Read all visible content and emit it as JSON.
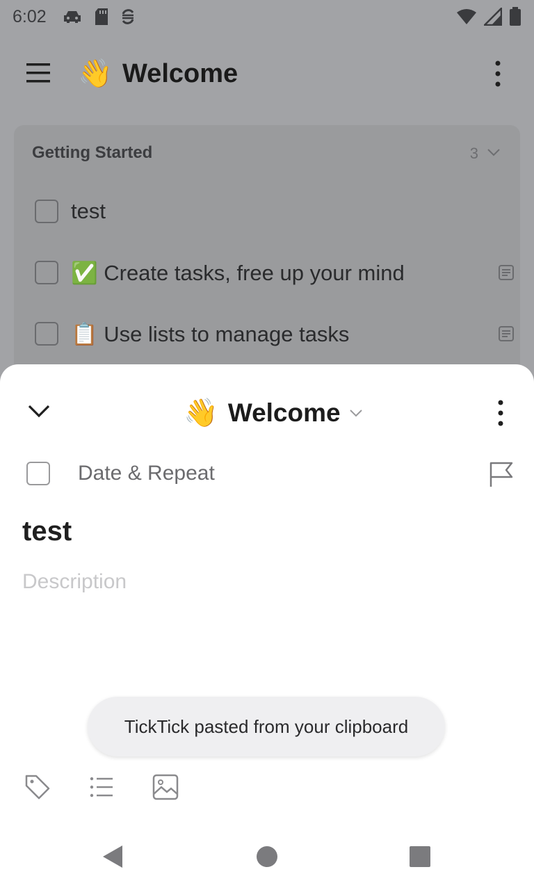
{
  "status_bar": {
    "time": "6:02",
    "left_icons": [
      "car-icon",
      "sd-card-icon",
      "sync-icon"
    ],
    "right_icons": [
      "wifi-icon",
      "signal-icon",
      "battery-icon"
    ]
  },
  "header": {
    "emoji": "👋",
    "title": "Welcome"
  },
  "section": {
    "title": "Getting Started",
    "count": "3",
    "tasks": [
      {
        "emoji": "",
        "text": "test",
        "has_note": false
      },
      {
        "emoji": "✅",
        "text": "Create tasks, free up your mind",
        "has_note": true
      },
      {
        "emoji": "📋",
        "text": "Use lists to manage tasks",
        "has_note": true
      }
    ]
  },
  "sheet": {
    "list_emoji": "👋",
    "list_name": "Welcome",
    "date_repeat": "Date & Repeat",
    "task_title": "test",
    "description_placeholder": "Description",
    "toast": "TickTick pasted from your clipboard",
    "toolbar_icons": [
      "tag-icon",
      "checklist-icon",
      "image-icon"
    ]
  },
  "colors": {
    "overlay": "#a2a3a6",
    "sheet": "#ffffff",
    "toast": "#efeff1"
  }
}
